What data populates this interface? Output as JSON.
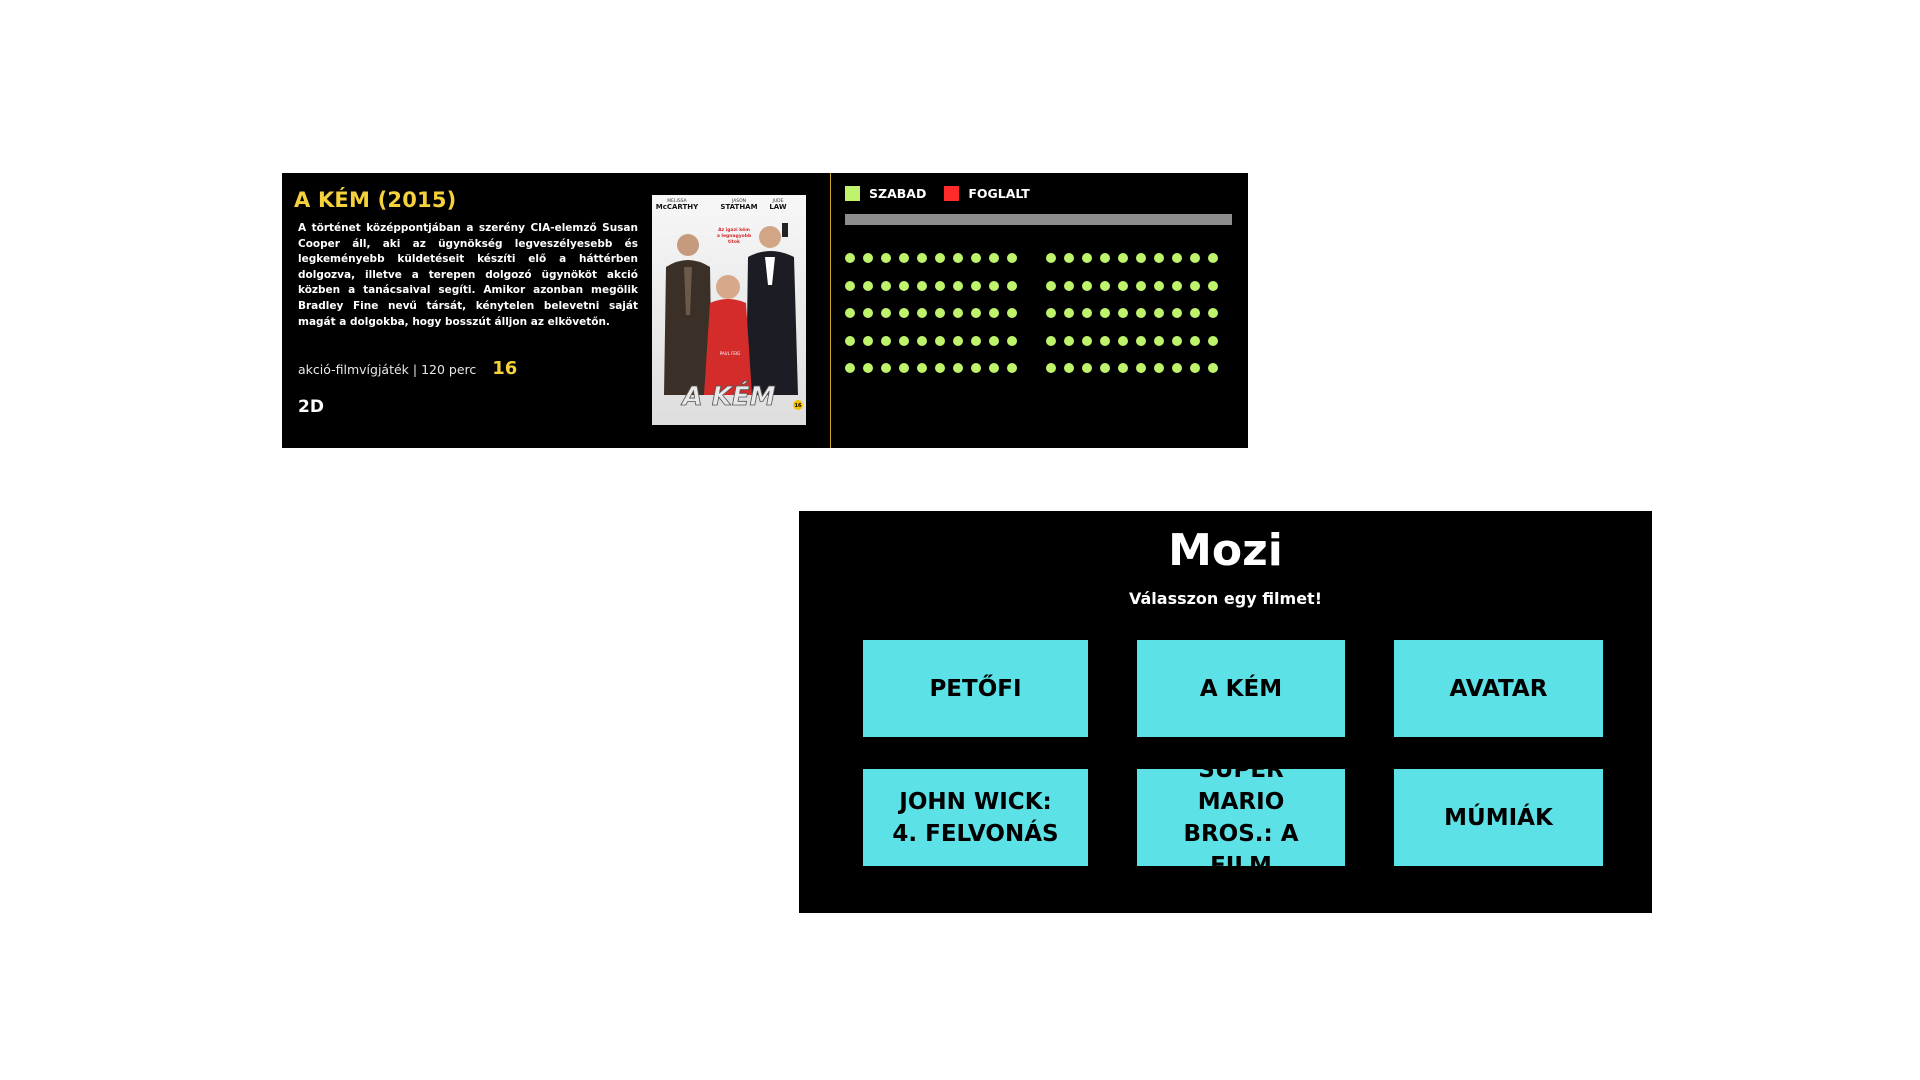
{
  "detail": {
    "title": "A KÉM (2015)",
    "description": "A történet középpontjában a szerény CIA-elemző Susan Cooper áll, aki az ügynökség legveszélyesebb és legkeményebb küldetéseit készíti elő a háttérben dolgozva, illetve a terepen dolgozó ügynököt akció közben a tanácsaival segíti. Amikor azonban megölik Bradley Fine nevű társát, kénytelen belevetni saját magát a dolgokba, hogy bosszút álljon az elkövetőn.",
    "genre_runtime": "akció-filmvígjáték | 120 perc",
    "age_rating": "16",
    "format": "2D",
    "poster": {
      "top_names": [
        "MELISSA",
        "McCARTHY",
        "JASON",
        "STATHAM",
        "JUDE",
        "LAW"
      ],
      "tagline": "Az igazi kém a legnagyobb titok",
      "credits_small": "PAUL FEIG",
      "big_title": "A KÉM",
      "age_badge": "16"
    }
  },
  "seating": {
    "legend": [
      {
        "label": "SZABAD",
        "color": "#bff36c"
      },
      {
        "label": "FOGLALT",
        "color": "#ff2b2b"
      }
    ],
    "rows": 5,
    "seats_per_block": 10,
    "blocks": 2,
    "free_color": "#bff36c",
    "occupied_color": "#ff2b2b"
  },
  "menu": {
    "title": "Mozi",
    "subtitle": "Válasszon egy filmet!",
    "movies": [
      {
        "label": "PETŐFI"
      },
      {
        "label": "A KÉM"
      },
      {
        "label": "AVATAR"
      },
      {
        "label": "JOHN WICK: 4. FELVONÁS"
      },
      {
        "label": "SUPER MARIO BROS.: A FILM"
      },
      {
        "label": "MÚMIÁK"
      }
    ]
  },
  "colors": {
    "accent_yellow": "#f5d23c",
    "button_cyan": "#5ce1e6",
    "panel_black": "#000000"
  }
}
